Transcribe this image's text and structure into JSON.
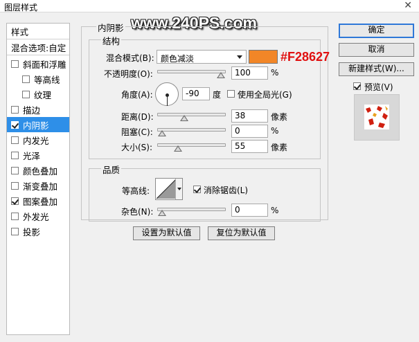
{
  "window": {
    "title": "图层样式",
    "close_glyph": "✕"
  },
  "watermark": "www.240PS.com",
  "left_panel": {
    "header": "样式",
    "blend_options": "混合选项:自定",
    "items": [
      {
        "label": "斜面和浮雕",
        "checked": false,
        "sub": false
      },
      {
        "label": "等高线",
        "checked": false,
        "sub": true
      },
      {
        "label": "纹理",
        "checked": false,
        "sub": true
      },
      {
        "label": "描边",
        "checked": false,
        "sub": false
      },
      {
        "label": "内阴影",
        "checked": true,
        "sub": false,
        "selected": true
      },
      {
        "label": "内发光",
        "checked": false,
        "sub": false
      },
      {
        "label": "光泽",
        "checked": false,
        "sub": false
      },
      {
        "label": "颜色叠加",
        "checked": false,
        "sub": false
      },
      {
        "label": "渐变叠加",
        "checked": false,
        "sub": false
      },
      {
        "label": "图案叠加",
        "checked": true,
        "sub": false
      },
      {
        "label": "外发光",
        "checked": false,
        "sub": false
      },
      {
        "label": "投影",
        "checked": false,
        "sub": false
      }
    ]
  },
  "inner_shadow": {
    "title": "内阴影",
    "structure": {
      "title": "结构",
      "blend_mode_label": "混合模式(B):",
      "blend_mode_value": "颜色减淡",
      "color": "#F28627",
      "color_annotation": "#F28627",
      "opacity_label": "不透明度(O):",
      "opacity_value": "100",
      "opacity_unit": "%",
      "opacity_level": 1.0,
      "angle_label": "角度(A):",
      "angle_value": "-90",
      "angle_unit": "度",
      "global_light_label": "使用全局光(G)",
      "global_light_checked": false,
      "distance_label": "距离(D):",
      "distance_value": "38",
      "distance_unit": "像素",
      "distance_level": 0.38,
      "choke_label": "阻塞(C):",
      "choke_value": "0",
      "choke_unit": "%",
      "choke_level": 0.0,
      "size_label": "大小(S):",
      "size_value": "55",
      "size_unit": "像素",
      "size_level": 0.27
    },
    "quality": {
      "title": "品质",
      "contour_label": "等高线:",
      "antialias_label": "消除锯齿(L)",
      "antialias_checked": true,
      "noise_label": "杂色(N):",
      "noise_value": "0",
      "noise_unit": "%",
      "noise_level": 0.0
    },
    "make_default": "设置为默认值",
    "reset_default": "复位为默认值"
  },
  "right_panel": {
    "ok": "确定",
    "cancel": "取消",
    "new_style": "新建样式(W)...",
    "preview_label": "预览(V)",
    "preview_checked": true
  }
}
